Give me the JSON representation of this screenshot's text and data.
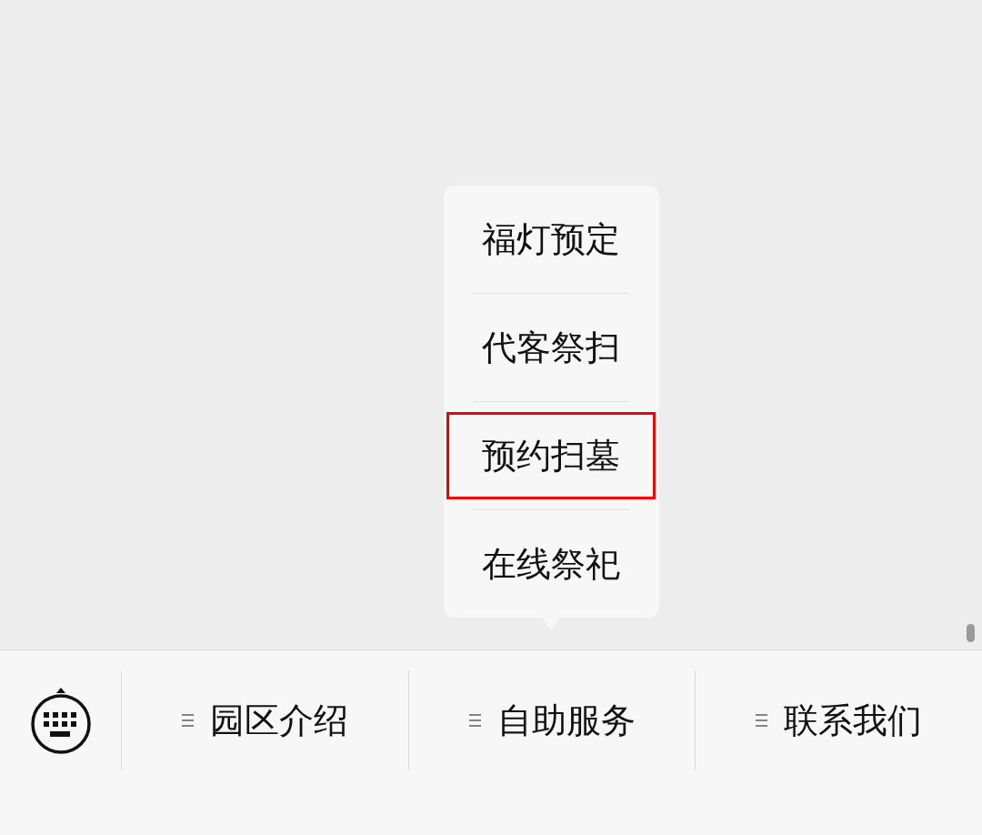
{
  "menu": [
    {
      "label": "园区介绍",
      "expanded": false
    },
    {
      "label": "自助服务",
      "expanded": true,
      "submenu": [
        {
          "label": "福灯预定",
          "highlighted": false
        },
        {
          "label": "代客祭扫",
          "highlighted": false
        },
        {
          "label": "预约扫墓",
          "highlighted": true
        },
        {
          "label": "在线祭祀",
          "highlighted": false
        }
      ]
    },
    {
      "label": "联系我们",
      "expanded": false
    }
  ]
}
